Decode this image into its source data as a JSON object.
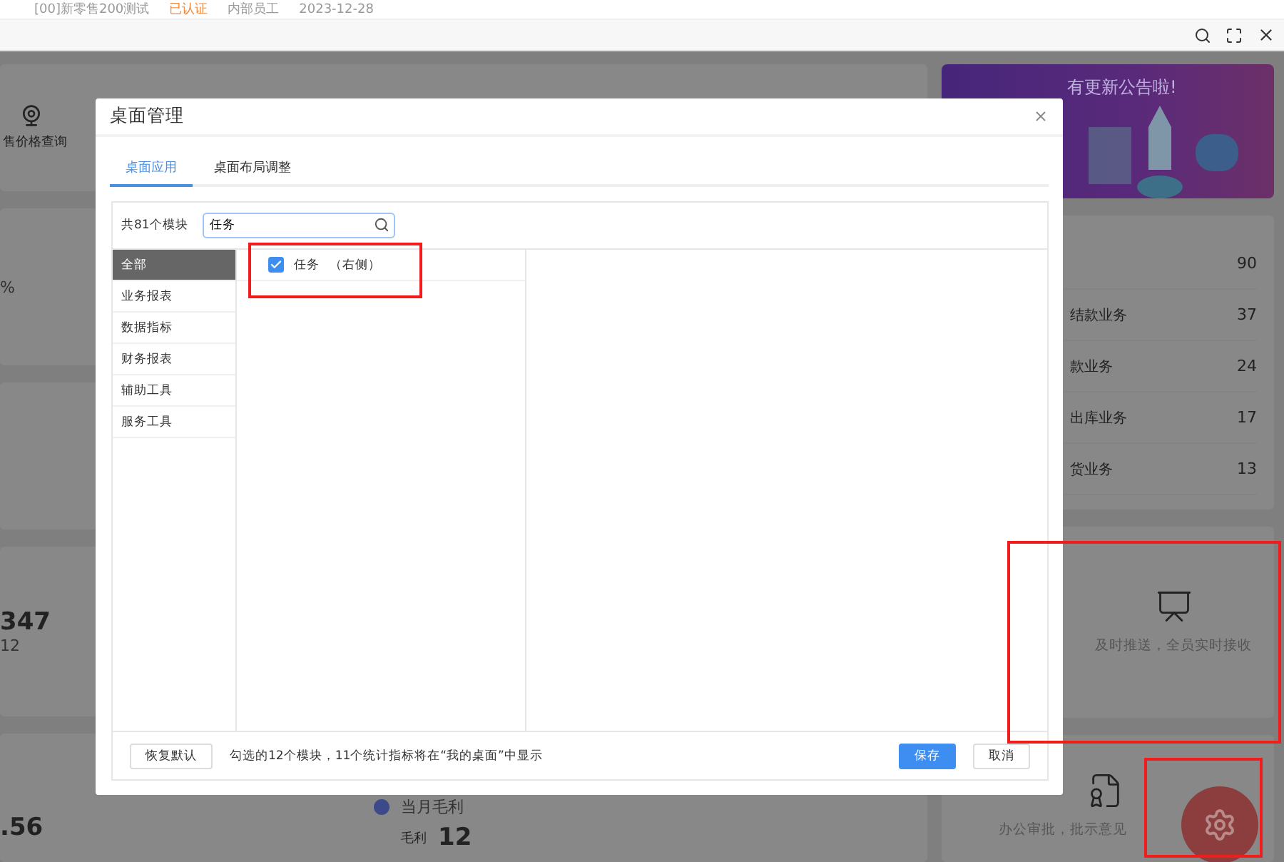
{
  "top_strip": {
    "store": "[00]新零售200测试",
    "badge": "已认证",
    "role": "内部员工",
    "date": "2023-12-28"
  },
  "dashboard": {
    "shortcut": {
      "label": "售价格查询"
    },
    "stat_1": {
      "value": "%"
    },
    "stat_2": {
      "value": "347",
      "sub": "12"
    },
    "stat_3": {
      "value": ".56"
    },
    "profit": {
      "title": "当月毛利",
      "label": "毛利",
      "value": "12"
    }
  },
  "side": {
    "banner": "有更新公告啦!",
    "tasks": [
      {
        "count": "90"
      },
      {
        "label": "结款业务",
        "count": "37"
      },
      {
        "label": "款业务",
        "count": "24"
      },
      {
        "label": "出库业务",
        "count": "17"
      },
      {
        "label": "货业务",
        "count": "13"
      }
    ],
    "push_card": {
      "text": "及时推送，全员实时接收"
    },
    "approval_card": {
      "text": "办公审批，批示意见"
    }
  },
  "dialog": {
    "title": "桌面管理",
    "tabs": [
      {
        "label": "桌面应用",
        "selected": true
      },
      {
        "label": "桌面布局调整",
        "selected": false
      }
    ],
    "count_label": "共81个模块",
    "search": {
      "value": "任务"
    },
    "categories": [
      {
        "label": "全部",
        "selected": true
      },
      {
        "label": "业务报表",
        "selected": false
      },
      {
        "label": "数据指标",
        "selected": false
      },
      {
        "label": "财务报表",
        "selected": false
      },
      {
        "label": "辅助工具",
        "selected": false
      },
      {
        "label": "服务工具",
        "selected": false
      }
    ],
    "modules": [
      {
        "name": "任务",
        "position": "（右侧）",
        "checked": true
      }
    ],
    "footer": {
      "reset": "恢复默认",
      "note": "勾选的12个模块，11个统计指标将在“我的桌面”中显示",
      "save": "保存",
      "cancel": "取消"
    }
  }
}
